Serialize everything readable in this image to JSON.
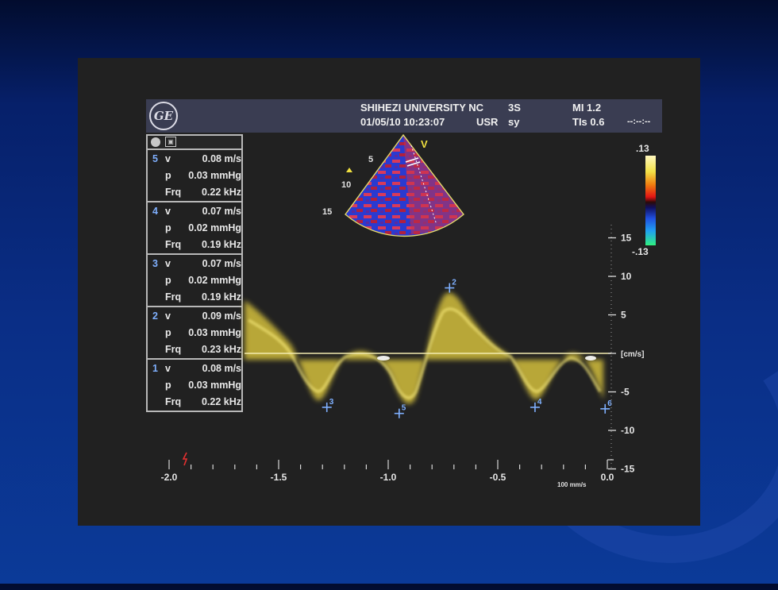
{
  "header": {
    "logo_text": "GE",
    "institution": "SHIHEZI UNIVERSITY NC",
    "datetime": "01/05/10 10:23:07",
    "user": "USR",
    "probe": "3S",
    "preset": "sy",
    "mi": "MI 1.2",
    "tis": "TIs 0.6",
    "timer": "--:--:--"
  },
  "measurements": [
    {
      "index": "5",
      "v_label": "v",
      "v": "0.08 m/s",
      "p_label": "p",
      "p": "0.03 mmHg",
      "frq_label": "Frq",
      "frq": "0.22 kHz"
    },
    {
      "index": "4",
      "v_label": "v",
      "v": "0.07 m/s",
      "p_label": "p",
      "p": "0.02 mmHg",
      "frq_label": "Frq",
      "frq": "0.19 kHz"
    },
    {
      "index": "3",
      "v_label": "v",
      "v": "0.07 m/s",
      "p_label": "p",
      "p": "0.02 mmHg",
      "frq_label": "Frq",
      "frq": "0.19 kHz"
    },
    {
      "index": "2",
      "v_label": "v",
      "v": "0.09 m/s",
      "p_label": "p",
      "p": "0.03 mmHg",
      "frq_label": "Frq",
      "frq": "0.23 kHz"
    },
    {
      "index": "1",
      "v_label": "v",
      "v": "0.08 m/s",
      "p_label": "p",
      "p": "0.03 mmHg",
      "frq_label": "Frq",
      "frq": "0.22 kHz"
    }
  ],
  "color_scale": {
    "max": ".13",
    "min": "-.13"
  },
  "sector": {
    "label": "V",
    "depth_labels": [
      "5",
      "10",
      "15"
    ]
  },
  "velocity_axis": {
    "ticks": [
      "15",
      "10",
      "5",
      "[cm/s]",
      "-5",
      "-10",
      "-15"
    ]
  },
  "time_axis": {
    "ticks": [
      "-2.0",
      "-1.5",
      "-1.0",
      "-0.5",
      "0.0"
    ],
    "sweep_speed": "100 mm/s"
  },
  "calipers": [
    {
      "id": "2",
      "time": -0.72,
      "velocity": 8.5
    },
    {
      "id": "3",
      "time": -1.28,
      "velocity": -7.0
    },
    {
      "id": "5",
      "time": -0.95,
      "velocity": -7.8
    },
    {
      "id": "4",
      "time": -0.33,
      "velocity": -7.0
    },
    {
      "id": "6",
      "time": -0.01,
      "velocity": -7.2
    }
  ]
}
